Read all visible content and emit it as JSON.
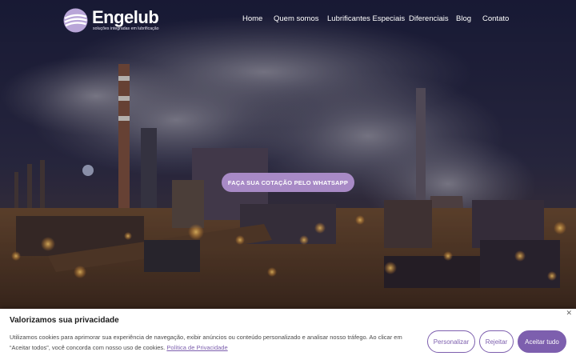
{
  "brand": {
    "name": "Engelub",
    "tagline": "soluções integradas em lubrificação"
  },
  "nav": {
    "items": [
      {
        "label": "Home"
      },
      {
        "label": "Quem somos"
      },
      {
        "label": "Lubrificantes Especiais"
      },
      {
        "label": "Diferenciais"
      },
      {
        "label": "Blog"
      },
      {
        "label": "Contato"
      }
    ]
  },
  "hero": {
    "cta_label": "FAÇA SUA COTAÇÃO PELO WHATSAPP"
  },
  "cookie_banner": {
    "title": "Valorizamos sua privacidade",
    "text": "Utilizamos cookies para aprimorar sua experiência de navegação, exibir anúncios ou conteúdo personalizado e analisar nosso tráfego. Ao clicar em “Aceitar todos”, você concorda com nosso uso de cookies.",
    "policy_link": "Política de Privacidade",
    "close_icon": "close-icon",
    "buttons": {
      "customize": "Personalizar",
      "reject": "Rejeitar",
      "accept_all": "Aceitar tudo"
    }
  },
  "colors": {
    "accent": "#7d5fae",
    "cta": "#a88ac6",
    "nav_text": "#ffffff"
  }
}
